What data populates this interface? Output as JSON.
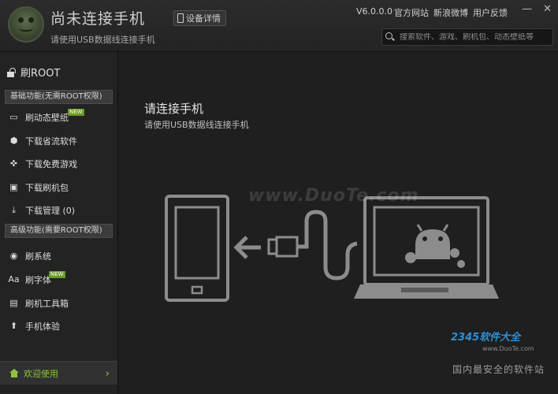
{
  "header": {
    "title": "尚未连接手机",
    "subtitle": "请使用USB数据线连接手机",
    "device_button": "设备详情",
    "version": "V6.0.0.0",
    "links": [
      "官方网站",
      "新浪微博",
      "用户反馈"
    ],
    "search_placeholder": "搜索软件、游戏、刷机包、动态壁纸等"
  },
  "sidebar": {
    "root_label": "刷ROOT",
    "section_basic": "基础功能(无需ROOT权限)",
    "section_advanced": "高级功能(需要ROOT权限)",
    "new_badge": "NEW",
    "basic_items": [
      {
        "label": "刷动态壁纸",
        "icon": "wallpaper-icon"
      },
      {
        "label": "下载省流软件",
        "icon": "box-icon"
      },
      {
        "label": "下载免费游戏",
        "icon": "gamepad-icon"
      },
      {
        "label": "下载刷机包",
        "icon": "package-icon"
      },
      {
        "label": "下载管理 (0)",
        "icon": "download-icon"
      }
    ],
    "advanced_items": [
      {
        "label": "刷系统",
        "icon": "system-icon"
      },
      {
        "label": "刷字体",
        "icon": "font-icon"
      },
      {
        "label": "刷机工具箱",
        "icon": "toolbox-icon"
      },
      {
        "label": "手机体验",
        "icon": "experience-icon"
      }
    ],
    "welcome_label": "欢迎使用"
  },
  "main": {
    "title": "请连接手机",
    "subtitle": "请使用USB数据线连接手机",
    "watermark": "www.DuoTe.com",
    "footer_brand": "2345软件大全",
    "footer_url": "www.DuoTe.com",
    "footer_slogan": "国内最安全的软件站"
  }
}
